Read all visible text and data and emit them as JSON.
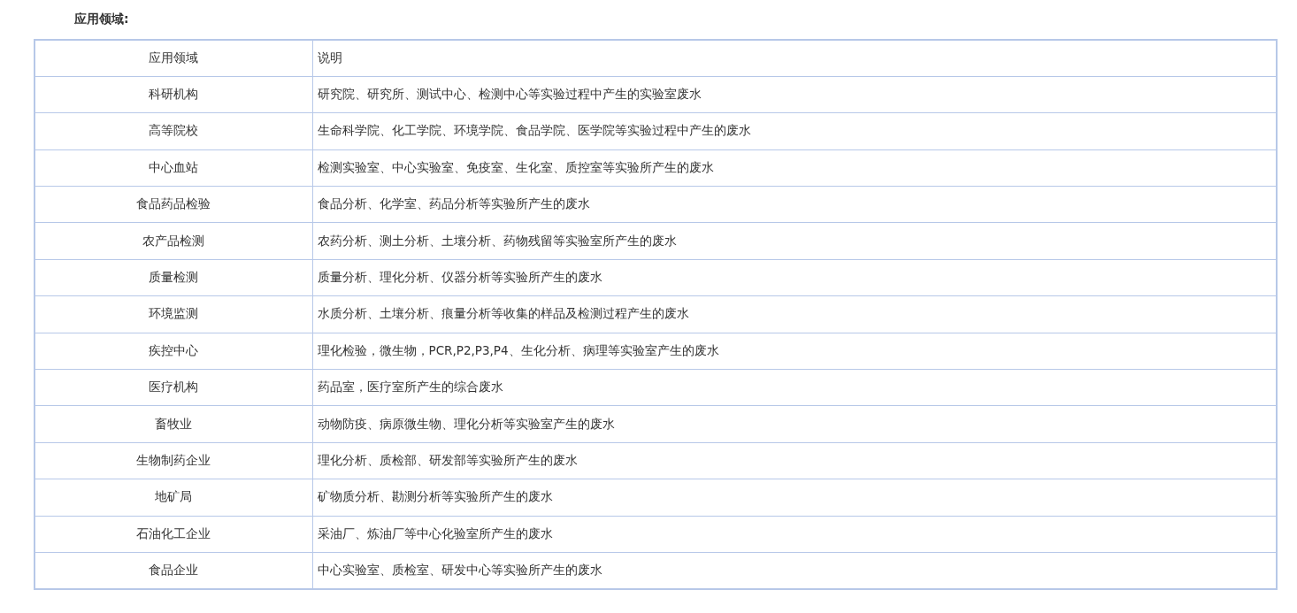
{
  "heading": "应用领域:",
  "table": {
    "columns": [
      "应用领域",
      "说明"
    ],
    "rows": [
      {
        "field": "科研机构",
        "description": "研究院、研究所、测试中心、检测中心等实验过程中产生的实验室废水"
      },
      {
        "field": "高等院校",
        "description": "生命科学院、化工学院、环境学院、食品学院、医学院等实验过程中产生的废水"
      },
      {
        "field": "中心血站",
        "description": "检测实验室、中心实验室、免疫室、生化室、质控室等实验所产生的废水"
      },
      {
        "field": "食品药品检验",
        "description": "食品分析、化学室、药品分析等实验所产生的废水"
      },
      {
        "field": "农产品检测",
        "description": "农药分析、测土分析、土壤分析、药物残留等实验室所产生的废水"
      },
      {
        "field": "质量检测",
        "description": "质量分析、理化分析、仪器分析等实验所产生的废水"
      },
      {
        "field": "环境监测",
        "description": "水质分析、土壤分析、痕量分析等收集的样品及检测过程产生的废水"
      },
      {
        "field": "疾控中心",
        "description": "理化检验，微生物，PCR,P2,P3,P4、生化分析、病理等实验室产生的废水"
      },
      {
        "field": "医疗机构",
        "description": "药品室，医疗室所产生的综合废水"
      },
      {
        "field": "畜牧业",
        "description": "动物防疫、病原微生物、理化分析等实验室产生的废水"
      },
      {
        "field": "生物制药企业",
        "description": "理化分析、质检部、研发部等实验所产生的废水"
      },
      {
        "field": "地矿局",
        "description": "矿物质分析、勘测分析等实验所产生的废水"
      },
      {
        "field": "石油化工企业",
        "description": "采油厂、炼油厂等中心化验室所产生的废水"
      },
      {
        "field": "食品企业",
        "description": "中心实验室、质检室、研发中心等实验所产生的废水"
      }
    ]
  }
}
